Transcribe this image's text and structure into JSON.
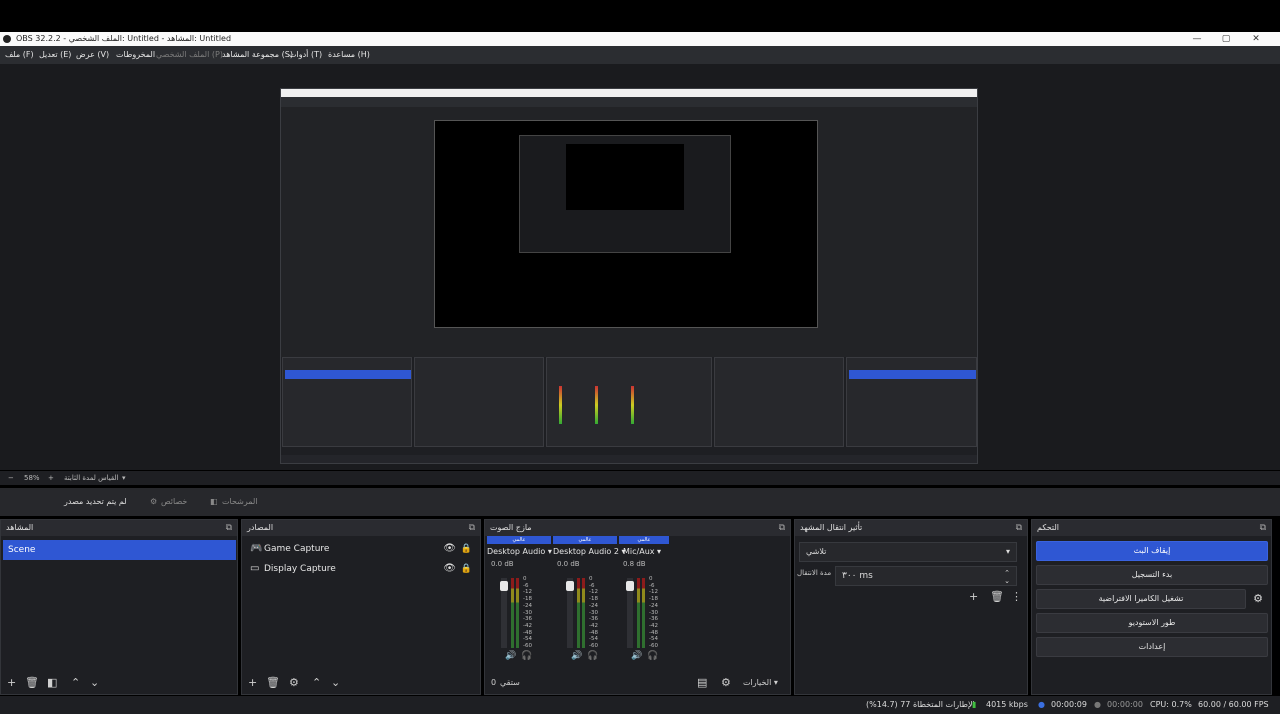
{
  "window": {
    "title": "OBS 32.2.2 - الملف الشخصي: Untitled - المشاهد: Untitled",
    "controls": [
      "—",
      "▢",
      "✕"
    ]
  },
  "menu": {
    "items": [
      {
        "label": "ملف (F)"
      },
      {
        "label": "تعديل (E)"
      },
      {
        "label": "عرض (V)"
      },
      {
        "label": "المخروطات"
      },
      {
        "label": "الملف الشخصي (P)",
        "disabled": true
      },
      {
        "label": "مجموعة المشاهد (S)"
      },
      {
        "label": "أدوات (T)"
      },
      {
        "label": "مساعدة (H)"
      }
    ]
  },
  "preview": {
    "zoom": "58%",
    "zoom_minus": "−",
    "zoom_plus": "+",
    "scale_label": "القياس لمدة الثابتة"
  },
  "source_toolbar": {
    "no_source": "لم يتم تحديد مصدر",
    "properties": "خصائص",
    "filters": "المرشحات"
  },
  "docks": {
    "scenes": {
      "title": "المشاهد",
      "items": [
        "Scene"
      ]
    },
    "sources": {
      "title": "المصادر",
      "items": [
        {
          "label": "Game Capture",
          "icon": "gamepad-icon"
        },
        {
          "label": "Display Capture",
          "icon": "monitor-icon"
        }
      ]
    },
    "mixer": {
      "title": "مازج الصوت",
      "channels": [
        {
          "name": "Desktop Audio",
          "tag": "عالمي",
          "db": "0.0 dB",
          "level": 0.95
        },
        {
          "name": "Desktop Audio 2",
          "tag": "عالمي",
          "db": "0.0 dB",
          "level": 0.95
        },
        {
          "name": "Mic/Aux",
          "tag": "عالمي",
          "db": "0.8 dB",
          "level": 0.95
        }
      ],
      "scale": [
        "0",
        "-6",
        "-12",
        "-18",
        "-24",
        "-30",
        "-36",
        "-42",
        "-48",
        "-54",
        "-60"
      ],
      "footer_left": "0",
      "footer_left2": "ستقي",
      "options": "الخيارات"
    },
    "transitions": {
      "title": "تأثير انتقال المشهد",
      "selected": "تلاشي",
      "duration_label": "مدة الانتقال",
      "duration_value": "٣٠٠ ms"
    },
    "controls": {
      "title": "التحكم",
      "buttons": [
        "إيقاف البث",
        "بدء التسجيل",
        "تشغيل الكاميرا الافتراضية",
        "طور الاستوديو",
        "إعدادات"
      ]
    }
  },
  "status": {
    "dropped": "الإطارات المتخطاة 77 (14.7%)",
    "bitrate": "4015 kbps",
    "stream_time": "00:00:09",
    "rec_time": "00:00:00",
    "cpu": "CPU: 0.7%",
    "fps": "60.00 / 60.00 FPS"
  }
}
